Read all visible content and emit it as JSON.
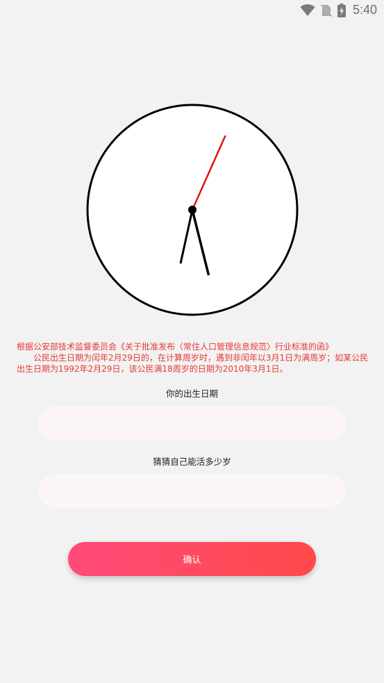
{
  "status_bar": {
    "time": "5:40",
    "icons": [
      "wifi-icon",
      "no-sim-icon",
      "battery-charging-icon"
    ]
  },
  "clock": {
    "hour": 5,
    "minute": 32,
    "second": 4,
    "colors": {
      "face": "#ffffff",
      "rim": "#000000",
      "second_hand": "#e01010",
      "hands": "#000000"
    }
  },
  "notice": {
    "line1": "根据公安部技术监督委员会《关于批准发布〈常住人口管理信息规范〉行业标准的函》",
    "line2": "公民出生日期为闰年2月29日的，在计算周岁时，遇到非闰年以3月1日为满周岁；如某公民出生日期为1992年2月29日，该公民满18周岁的日期为2010年3月1日。",
    "color": "#e53935"
  },
  "form": {
    "birthdate_label": "你的出生日期",
    "birthdate_value": "",
    "lifespan_label": "猜猜自己能活多少岁",
    "lifespan_value": ""
  },
  "confirm_button": {
    "label": "确认",
    "gradient": [
      "#ff4a7a",
      "#ff4949"
    ]
  }
}
